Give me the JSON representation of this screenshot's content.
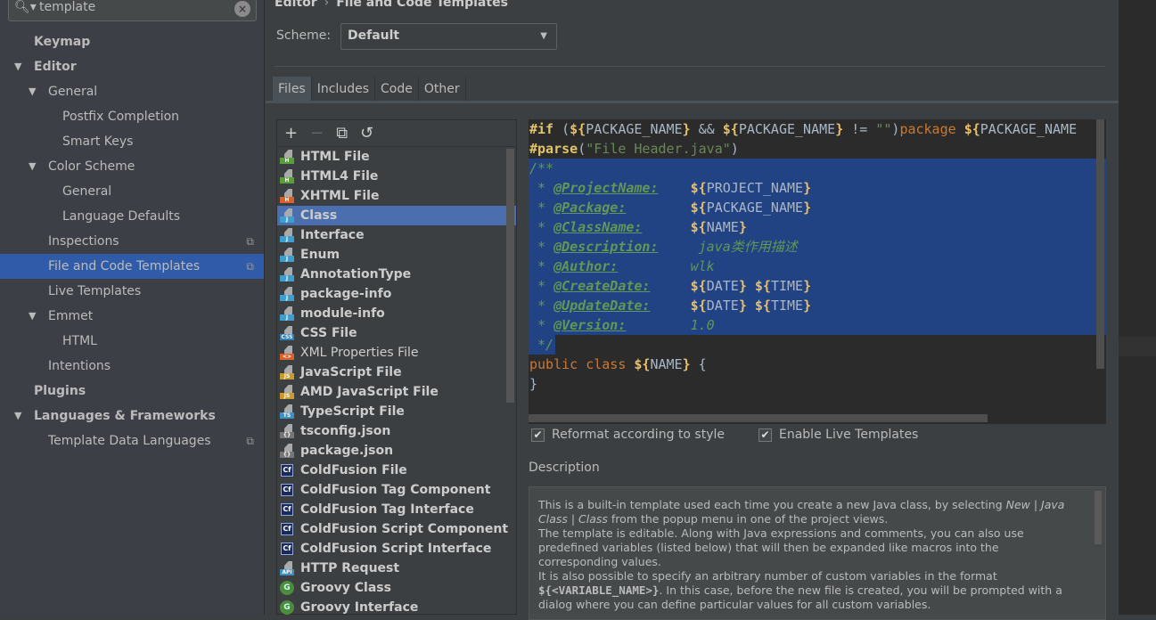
{
  "search": {
    "value": "template"
  },
  "sidebar": {
    "items": [
      {
        "label": "Keymap",
        "level": 1,
        "bold": true
      },
      {
        "label": "Editor",
        "level": 1,
        "bold": true,
        "expanded": true
      },
      {
        "label": "General",
        "level": 2,
        "expanded": true
      },
      {
        "label": "Postfix Completion",
        "level": 3
      },
      {
        "label": "Smart Keys",
        "level": 3
      },
      {
        "label": "Color Scheme",
        "level": 2,
        "expanded": true
      },
      {
        "label": "General",
        "level": 3
      },
      {
        "label": "Language Defaults",
        "level": 3
      },
      {
        "label": "Inspections",
        "level": 2,
        "copy": true
      },
      {
        "label": "File and Code Templates",
        "level": 2,
        "copy": true,
        "selected": true
      },
      {
        "label": "Live Templates",
        "level": 2
      },
      {
        "label": "Emmet",
        "level": 2,
        "expanded": true
      },
      {
        "label": "HTML",
        "level": 3
      },
      {
        "label": "Intentions",
        "level": 2
      },
      {
        "label": "Plugins",
        "level": 1,
        "bold": true
      },
      {
        "label": "Languages & Frameworks",
        "level": 1,
        "bold": true,
        "expanded": true
      },
      {
        "label": "Template Data Languages",
        "level": 2,
        "copy": true
      }
    ]
  },
  "breadcrumb": {
    "parent": "Editor",
    "separator": "›",
    "current": "File and Code Templates"
  },
  "scheme": {
    "label": "Scheme:",
    "value": "Default"
  },
  "tabs": [
    {
      "label": "Files",
      "active": true
    },
    {
      "label": "Includes"
    },
    {
      "label": "Code"
    },
    {
      "label": "Other"
    }
  ],
  "toolbar": {
    "add": "+",
    "remove": "−",
    "copy": "⧉",
    "reset": "↺"
  },
  "files": [
    {
      "label": "HTML File",
      "icon": "html",
      "color": "#5a9e3c"
    },
    {
      "label": "HTML4 File",
      "icon": "html",
      "color": "#5a9e3c"
    },
    {
      "label": "XHTML File",
      "icon": "html",
      "color": "#d9622b"
    },
    {
      "label": "Class",
      "icon": "java",
      "color": "#3e9fcf",
      "selected": true
    },
    {
      "label": "Interface",
      "icon": "java",
      "color": "#3e9fcf"
    },
    {
      "label": "Enum",
      "icon": "java",
      "color": "#3e9fcf"
    },
    {
      "label": "AnnotationType",
      "icon": "java",
      "color": "#3e9fcf"
    },
    {
      "label": "package-info",
      "icon": "java",
      "color": "#3e9fcf"
    },
    {
      "label": "module-info",
      "icon": "java",
      "color": "#3e9fcf"
    },
    {
      "label": "CSS File",
      "icon": "css",
      "color": "#2f7fb8",
      "badge": "CSS"
    },
    {
      "label": "XML Properties File",
      "icon": "xml",
      "color": "#d9622b",
      "badge": "<>",
      "normal": true
    },
    {
      "label": "JavaScript File",
      "icon": "js",
      "color": "#c99a2e",
      "badge": "JS"
    },
    {
      "label": "AMD JavaScript File",
      "icon": "js",
      "color": "#c99a2e",
      "badge": "JS"
    },
    {
      "label": "TypeScript File",
      "icon": "ts",
      "color": "#3e8fbf",
      "badge": "TS"
    },
    {
      "label": "tsconfig.json",
      "icon": "json",
      "color": "#777",
      "badge": "{}"
    },
    {
      "label": "package.json",
      "icon": "json",
      "color": "#777",
      "badge": "{}"
    },
    {
      "label": "ColdFusion File",
      "icon": "coldfusion",
      "badge": "Cf"
    },
    {
      "label": "ColdFusion Tag Component",
      "icon": "coldfusion",
      "badge": "Cf"
    },
    {
      "label": "ColdFusion Tag Interface",
      "icon": "coldfusion",
      "badge": "Cf"
    },
    {
      "label": "ColdFusion Script Component",
      "icon": "coldfusion",
      "badge": "Cf"
    },
    {
      "label": "ColdFusion Script Interface",
      "icon": "coldfusion",
      "badge": "Cf"
    },
    {
      "label": "HTTP Request",
      "icon": "api",
      "color": "#3e8fbf",
      "badge": "API"
    },
    {
      "label": "Groovy Class",
      "icon": "groovy",
      "badge": "G"
    },
    {
      "label": "Groovy Interface",
      "icon": "groovy",
      "badge": "G"
    }
  ],
  "code": [
    {
      "t": [
        [
          "#if",
          "directive"
        ],
        [
          " (",
          "plain"
        ],
        [
          "${",
          "dv"
        ],
        [
          "PACKAGE_NAME",
          "vn"
        ],
        [
          "}",
          "dv"
        ],
        [
          " && ",
          "plain"
        ],
        [
          "${",
          "dv"
        ],
        [
          "PACKAGE_NAME",
          "vn"
        ],
        [
          "}",
          "dv"
        ],
        [
          " != ",
          "plain"
        ],
        [
          "\"\"",
          "str"
        ],
        [
          ")",
          "plain"
        ],
        [
          "package",
          "kw"
        ],
        [
          " ",
          "plain"
        ],
        [
          "${",
          "dv"
        ],
        [
          "PACKAGE_NAME",
          "vn"
        ]
      ]
    },
    {
      "t": [
        [
          "#parse",
          "directive"
        ],
        [
          "(",
          "plain"
        ],
        [
          "\"File Header.java\"",
          "str"
        ],
        [
          ")",
          "plain"
        ]
      ]
    },
    {
      "sel": "full",
      "t": [
        [
          "/**",
          "cm"
        ]
      ]
    },
    {
      "sel": "full",
      "t": [
        [
          " * ",
          "cm"
        ],
        [
          "@ProjectName:",
          "tag"
        ],
        [
          "    ",
          "cm"
        ],
        [
          "${",
          "dv"
        ],
        [
          "PROJECT_NAME",
          "vn"
        ],
        [
          "}",
          "dv"
        ]
      ]
    },
    {
      "sel": "full",
      "t": [
        [
          " * ",
          "cm"
        ],
        [
          "@Package:",
          "tag"
        ],
        [
          "        ",
          "cm"
        ],
        [
          "${",
          "dv"
        ],
        [
          "PACKAGE_NAME",
          "vn"
        ],
        [
          "}",
          "dv"
        ]
      ]
    },
    {
      "sel": "full",
      "t": [
        [
          " * ",
          "cm"
        ],
        [
          "@ClassName:",
          "tag"
        ],
        [
          "      ",
          "cm"
        ],
        [
          "${",
          "dv"
        ],
        [
          "NAME",
          "vn"
        ],
        [
          "}",
          "dv"
        ]
      ]
    },
    {
      "sel": "full",
      "t": [
        [
          " * ",
          "cm"
        ],
        [
          "@Description:",
          "tag"
        ],
        [
          "     java类作用描述",
          "cmv"
        ]
      ]
    },
    {
      "sel": "full",
      "t": [
        [
          " * ",
          "cm"
        ],
        [
          "@Author:",
          "tag"
        ],
        [
          "         wlk",
          "cmv"
        ]
      ]
    },
    {
      "sel": "full",
      "t": [
        [
          " * ",
          "cm"
        ],
        [
          "@CreateDate:",
          "tag"
        ],
        [
          "     ",
          "cm"
        ],
        [
          "${",
          "dv"
        ],
        [
          "DATE",
          "vn"
        ],
        [
          "}",
          "dv"
        ],
        [
          " ",
          "cm"
        ],
        [
          "${",
          "dv"
        ],
        [
          "TIME",
          "vn"
        ],
        [
          "}",
          "dv"
        ]
      ]
    },
    {
      "sel": "full",
      "t": [
        [
          " * ",
          "cm"
        ],
        [
          "@UpdateDate:",
          "tag"
        ],
        [
          "     ",
          "cm"
        ],
        [
          "${",
          "dv"
        ],
        [
          "DATE",
          "vn"
        ],
        [
          "}",
          "dv"
        ],
        [
          " ",
          "cm"
        ],
        [
          "${",
          "dv"
        ],
        [
          "TIME",
          "vn"
        ],
        [
          "}",
          "dv"
        ]
      ]
    },
    {
      "sel": "full",
      "t": [
        [
          " * ",
          "cm"
        ],
        [
          "@Version:",
          "tag"
        ],
        [
          "        1.0",
          "cmv"
        ]
      ]
    },
    {
      "sel": "partial",
      "t": [
        [
          " */",
          "cm"
        ]
      ]
    },
    {
      "t": [
        [
          "public class ",
          "kw"
        ],
        [
          "${",
          "dv"
        ],
        [
          "NAME",
          "vn"
        ],
        [
          "}",
          "dv"
        ],
        [
          " {",
          "plain"
        ]
      ]
    },
    {
      "t": [
        [
          "}",
          "plain"
        ]
      ]
    }
  ],
  "options": {
    "reformat": {
      "label": "Reformat according to style",
      "checked": true
    },
    "live_templates": {
      "label": "Enable Live Templates",
      "checked": true
    }
  },
  "description": {
    "label": "Description",
    "p1a": "This is a built-in template used each time you create a new Java class, by selecting ",
    "p1i": "New | Java Class | Class",
    "p1b": " from the popup menu in one of the project views.",
    "p2": "The template is editable. Along with Java expressions and comments, you can also use predefined variables (listed below) that will then be expanded like macros into the corresponding values.",
    "p3a": "It is also possible to specify an arbitrary number of custom variables in the format ",
    "p3b": "${<VARIABLE_NAME>}",
    "p3c": ". In this case, before the new file is created, you will be prompted with a dialog where you can define particular values for all custom variables."
  }
}
